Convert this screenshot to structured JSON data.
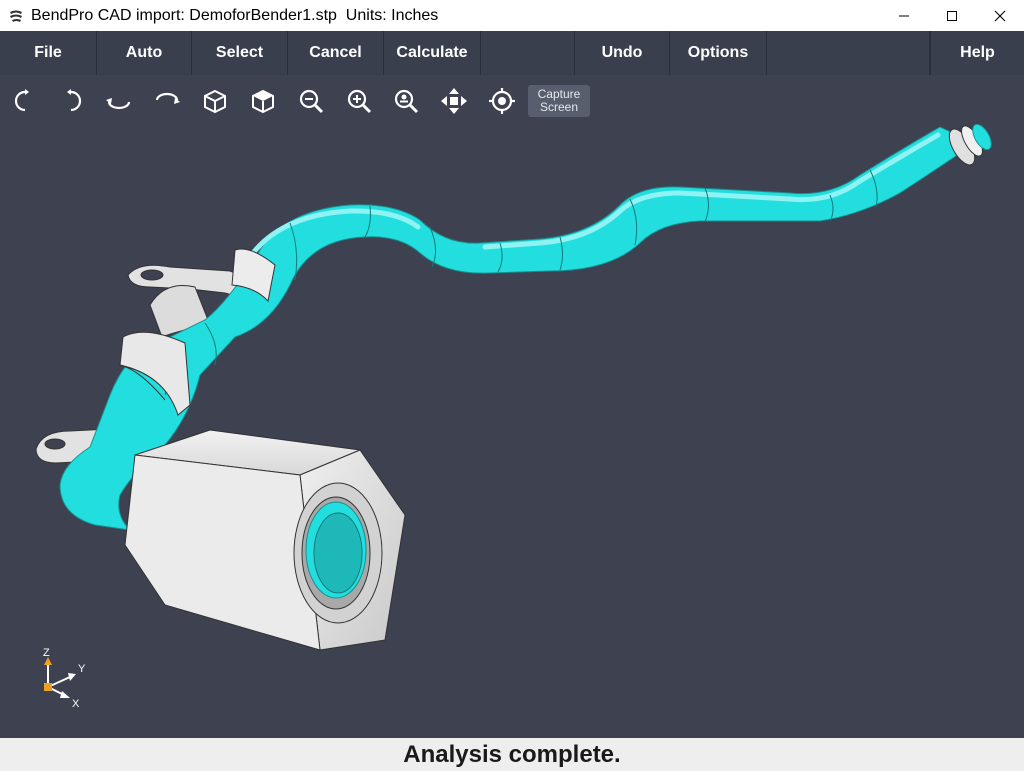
{
  "window": {
    "title": "BendPro CAD import: DemoforBender1.stp  Units: Inches",
    "minimize_icon": "minimize-icon",
    "maximize_icon": "maximize-icon",
    "close_icon": "close-icon"
  },
  "menu": {
    "file": "File",
    "auto": "Auto",
    "select": "Select",
    "cancel": "Cancel",
    "calculate": "Calculate",
    "undo": "Undo",
    "options": "Options",
    "help": "Help"
  },
  "toolbar": {
    "tools": [
      "rotate-left-icon",
      "rotate-right-icon",
      "rotate-up-icon",
      "rotate-down-icon",
      "iso-view-front-icon",
      "iso-view-back-icon",
      "zoom-out-icon",
      "zoom-in-icon",
      "zoom-fit-icon",
      "pan-icon",
      "center-icon"
    ],
    "capture_line1": "Capture",
    "capture_line2": "Screen"
  },
  "axes": {
    "z": "Z",
    "y": "Y",
    "x": "X"
  },
  "colors": {
    "tube": "#22dede",
    "fitting": "#e6e6e6",
    "background": "#3d4150",
    "menubar": "#3a3f4d"
  },
  "status": {
    "text": "Analysis complete."
  }
}
